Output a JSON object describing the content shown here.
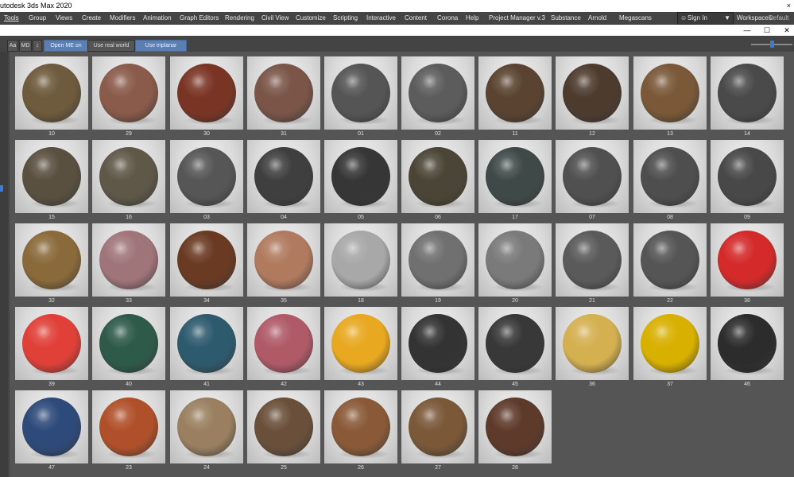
{
  "window": {
    "title": "utodesk 3ds Max 2020",
    "close_glyph": "×"
  },
  "menu": [
    "Tools",
    "Group",
    "Views",
    "Create",
    "Modifiers",
    "Animation",
    "Graph Editors",
    "Rendering",
    "Civil View",
    "Customize",
    "Scripting",
    "Interactive",
    "Content",
    "Corona",
    "Help",
    "Project Manager v.3",
    "Substance",
    "Arnold",
    "Megascans"
  ],
  "account": {
    "sign_in": "Sign In",
    "workspaces_label": "Workspaces:",
    "workspace_value": "Default"
  },
  "toolbar": {
    "aa": "Aa",
    "md": "MD",
    "sort": "↕",
    "open_me": "Open ME on apply",
    "real_world": "Use real world scale",
    "triplanar": "Use triplanar mapping"
  },
  "window_controls": {
    "minimize": "—",
    "maximize": "☐",
    "close": "✕"
  },
  "materials": [
    {
      "label": "10",
      "color": "#6e5a3c"
    },
    {
      "label": "29",
      "color": "#8a5a4a"
    },
    {
      "label": "30",
      "color": "#7a3424"
    },
    {
      "label": "31",
      "color": "#7a5548"
    },
    {
      "label": "01",
      "color": "#555555"
    },
    {
      "label": "02",
      "color": "#5c5c5c"
    },
    {
      "label": "11",
      "color": "#5a4330"
    },
    {
      "label": "12",
      "color": "#4d3b2e"
    },
    {
      "label": "13",
      "color": "#7a5838"
    },
    {
      "label": "14",
      "color": "#4a4a4a"
    },
    {
      "label": "15",
      "color": "#5a5040"
    },
    {
      "label": "16",
      "color": "#5f5848"
    },
    {
      "label": "03",
      "color": "#565656"
    },
    {
      "label": "04",
      "color": "#3f3f3f"
    },
    {
      "label": "05",
      "color": "#363636"
    },
    {
      "label": "06",
      "color": "#4a4536"
    },
    {
      "label": "17",
      "color": "#3f4a48"
    },
    {
      "label": "07",
      "color": "#505050"
    },
    {
      "label": "08",
      "color": "#4e4e4e"
    },
    {
      "label": "09",
      "color": "#484848"
    },
    {
      "label": "32",
      "color": "#8a6a3a"
    },
    {
      "label": "33",
      "color": "#a0757a"
    },
    {
      "label": "34",
      "color": "#6a3a22"
    },
    {
      "label": "35",
      "color": "#b07a5e"
    },
    {
      "label": "18",
      "color": "#a8a8a8"
    },
    {
      "label": "19",
      "color": "#707070"
    },
    {
      "label": "20",
      "color": "#7a7a7a"
    },
    {
      "label": "21",
      "color": "#5a5a5a"
    },
    {
      "label": "22",
      "color": "#555555"
    },
    {
      "label": "38",
      "color": "#d42a2a"
    },
    {
      "label": "39",
      "color": "#e04038"
    },
    {
      "label": "40",
      "color": "#2e5a4a"
    },
    {
      "label": "41",
      "color": "#2e5a6e"
    },
    {
      "label": "42",
      "color": "#b05a68"
    },
    {
      "label": "43",
      "color": "#e8a820"
    },
    {
      "label": "44",
      "color": "#333333"
    },
    {
      "label": "45",
      "color": "#383838"
    },
    {
      "label": "36",
      "color": "#d4b050"
    },
    {
      "label": "37",
      "color": "#d8b000"
    },
    {
      "label": "46",
      "color": "#2c2c2c"
    },
    {
      "label": "47",
      "color": "#2e4a7a"
    },
    {
      "label": "23",
      "color": "#b0502a"
    },
    {
      "label": "24",
      "color": "#9a8060"
    },
    {
      "label": "25",
      "color": "#6a503a"
    },
    {
      "label": "26",
      "color": "#8a5a38"
    },
    {
      "label": "27",
      "color": "#7a5838"
    },
    {
      "label": "28",
      "color": "#5e3a2a"
    }
  ]
}
